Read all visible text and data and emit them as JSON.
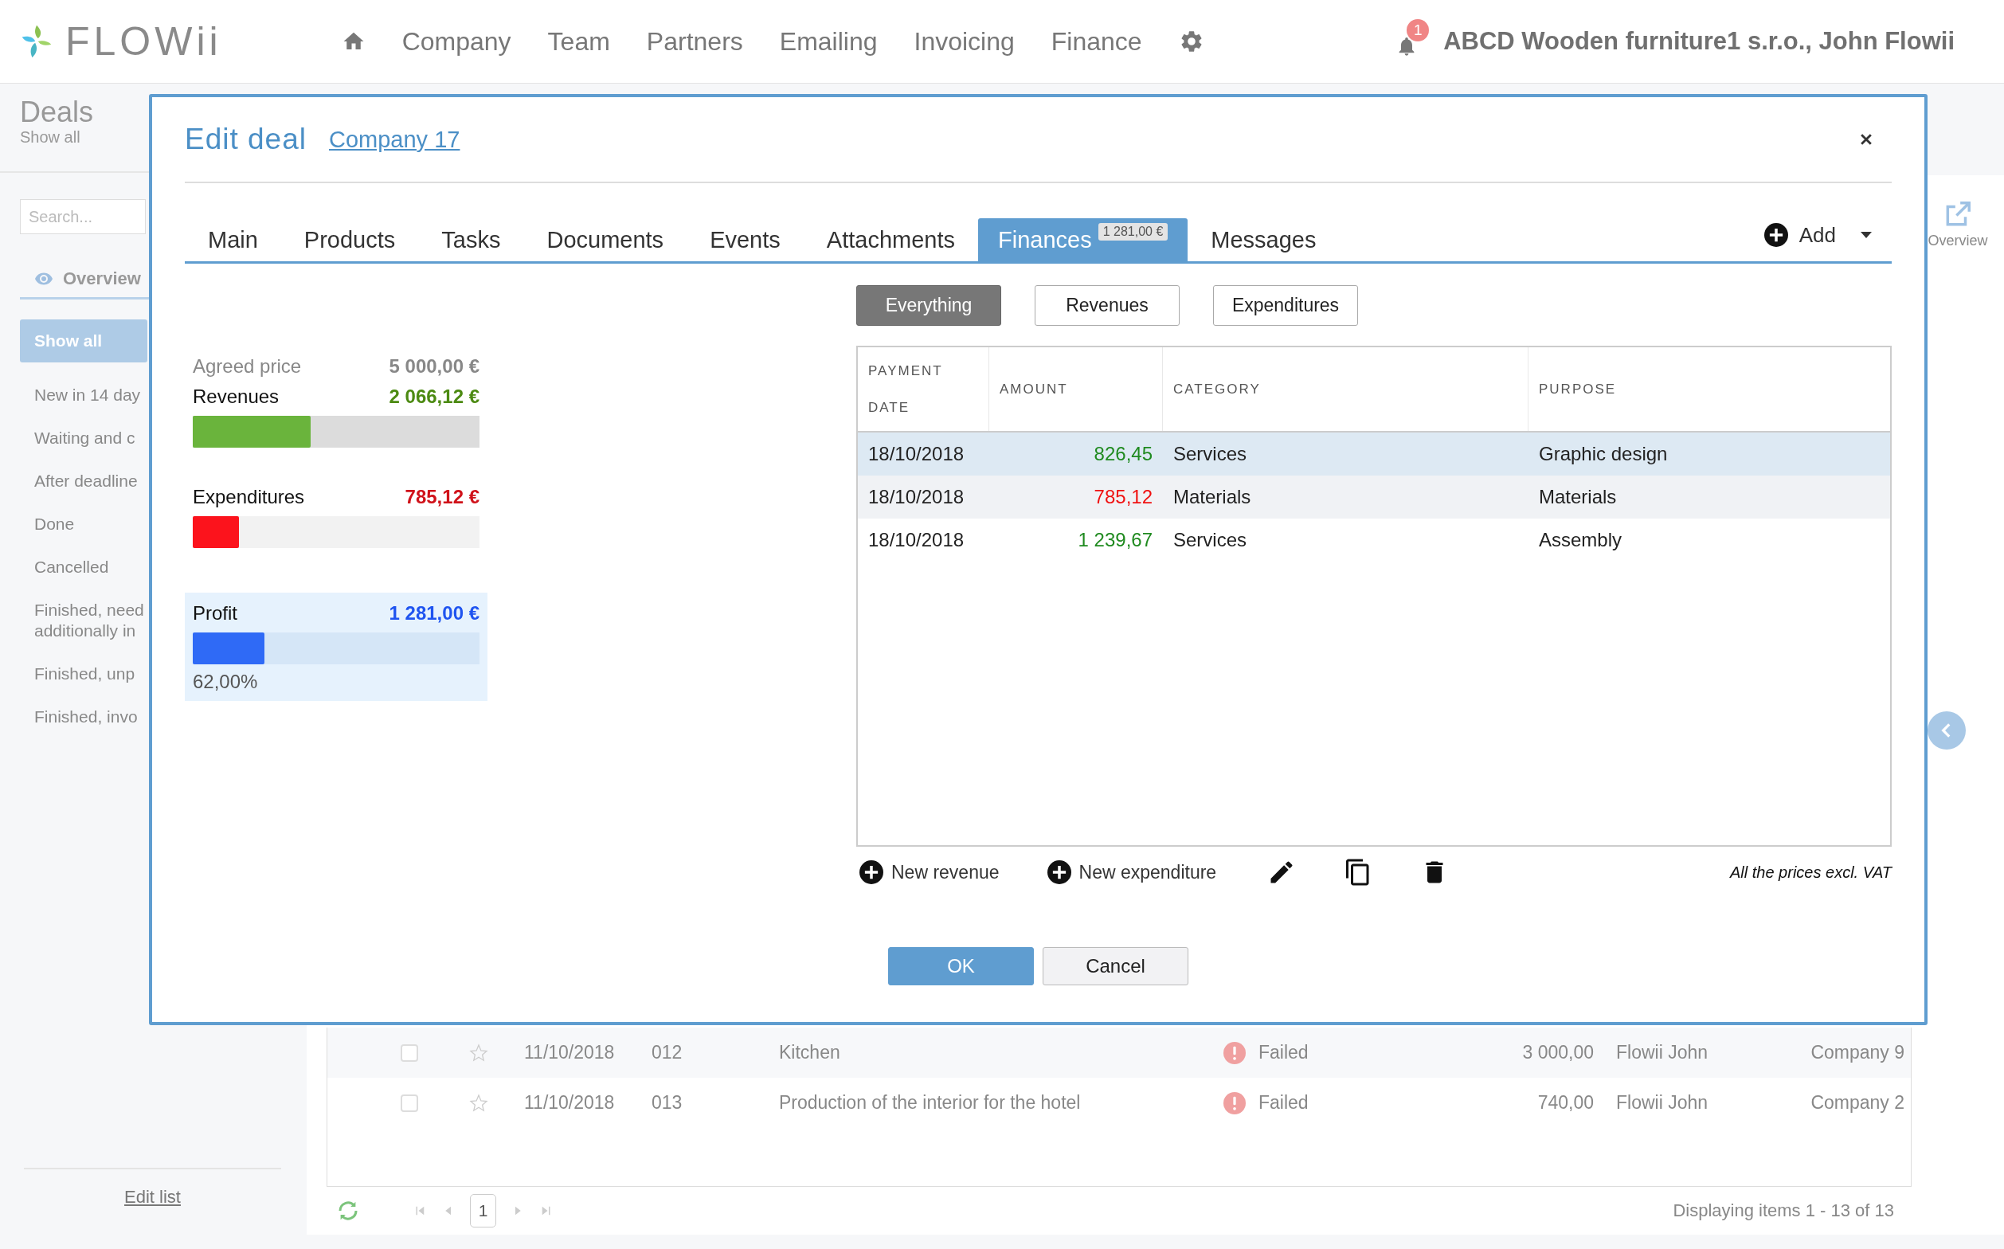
{
  "header": {
    "logo": "FLOWii",
    "nav": [
      "Company",
      "Team",
      "Partners",
      "Emailing",
      "Invoicing",
      "Finance"
    ],
    "notifications": "1",
    "account": "ABCD Wooden furniture1 s.r.o., John Flowii"
  },
  "sidebar": {
    "title": "Deals",
    "subtitle": "Show all",
    "search": {
      "placeholder": "Search..."
    },
    "tab": "Overview",
    "items": [
      {
        "label": "Show all",
        "selected": true
      },
      {
        "label": "New in 14 day",
        "selected": false
      },
      {
        "label": "Waiting and c",
        "selected": false
      },
      {
        "label": "After deadline",
        "selected": false
      },
      {
        "label": "Done",
        "selected": false
      },
      {
        "label": "Cancelled",
        "selected": false
      },
      {
        "label": "Finished, need additionally in",
        "selected": false
      },
      {
        "label": "Finished, unp",
        "selected": false
      },
      {
        "label": "Finished, invo",
        "selected": false
      }
    ],
    "edit_link": "Edit list"
  },
  "side_tools": {
    "overview": "Overview"
  },
  "list": {
    "rows": [
      {
        "checked": false,
        "starred": false,
        "date": "11/10/2018",
        "number": "012",
        "name": "Kitchen",
        "status": "Failed",
        "amount": "3 000,00",
        "owner": "Flowii John",
        "company": "Company 9"
      },
      {
        "checked": false,
        "starred": false,
        "date": "11/10/2018",
        "number": "013",
        "name": "Production of the interior for the hotel",
        "status": "Failed",
        "amount": "740,00",
        "owner": "Flowii John",
        "company": "Company 2"
      }
    ],
    "pagination": {
      "page": "1",
      "summary": "Displaying items 1 - 13 of 13"
    }
  },
  "dialog": {
    "title": "Edit deal",
    "company": "Company 17",
    "tabs": [
      {
        "label": "Main",
        "selected": false
      },
      {
        "label": "Products",
        "selected": false
      },
      {
        "label": "Tasks",
        "selected": false
      },
      {
        "label": "Documents",
        "selected": false
      },
      {
        "label": "Events",
        "selected": false
      },
      {
        "label": "Attachments",
        "selected": false
      },
      {
        "label": "Finances",
        "selected": true,
        "badge": "1 281,00 €"
      },
      {
        "label": "Messages",
        "selected": false
      }
    ],
    "add": "Add",
    "summary": [
      {
        "kind": "agreed",
        "label": "Agreed price",
        "value": "5 000,00 €"
      },
      {
        "kind": "revenue",
        "label": "Revenues",
        "value": "2 066,12 €",
        "level": 0.41
      },
      {
        "kind": "expenditure",
        "label": "Expenditures",
        "value": "785,12 €",
        "level": 0.16
      },
      {
        "kind": "profit",
        "label": "Profit",
        "value": "1 281,00 €",
        "level": 0.25,
        "percent": "62,00%"
      }
    ],
    "filters": [
      {
        "label": "Everything",
        "selected": true
      },
      {
        "label": "Revenues",
        "selected": false
      },
      {
        "label": "Expenditures",
        "selected": false
      }
    ],
    "columns": [
      "PAYMENT DATE",
      "AMOUNT",
      "CATEGORY",
      "PURPOSE"
    ],
    "rows": [
      {
        "selected": true,
        "kind": "revenue",
        "date": "18/10/2018",
        "amount": "826,45",
        "category": "Services",
        "purpose": "Graphic design"
      },
      {
        "selected": false,
        "kind": "expenditure",
        "date": "18/10/2018",
        "amount": "785,12",
        "category": "Materials",
        "purpose": "Materials"
      },
      {
        "selected": false,
        "kind": "revenue",
        "date": "18/10/2018",
        "amount": "1 239,67",
        "category": "Services",
        "purpose": "Assembly"
      }
    ],
    "actions": [
      {
        "kind": "new",
        "label": "New revenue"
      },
      {
        "kind": "new",
        "label": "New expenditure"
      },
      {
        "kind": "edit"
      },
      {
        "kind": "copy"
      },
      {
        "kind": "delete"
      }
    ],
    "note": "All the prices excl. VAT",
    "buttons": [
      {
        "kind": "primary",
        "label": "OK"
      },
      {
        "kind": "secondary",
        "label": "Cancel"
      }
    ]
  }
}
